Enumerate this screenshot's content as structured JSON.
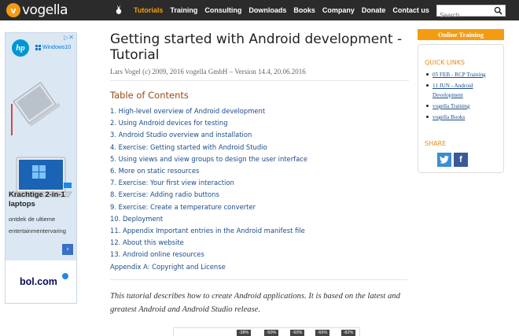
{
  "header": {
    "logo_text": "vogella",
    "nav": [
      "Tutorials",
      "Training",
      "Consulting",
      "Downloads",
      "Books",
      "Company",
      "Donate",
      "Contact us"
    ],
    "search_placeholder": "Search"
  },
  "ad": {
    "brand": "hp",
    "os_label": "Windows10",
    "title": "Krachtige 2-in-1 laptops",
    "subtitle": "ontdek de ultieme entertainmentervaring",
    "shop": "bol.com"
  },
  "article": {
    "title": "Getting started with Android development - Tutorial",
    "byline": "Lars Vogel (c) 2009, 2016 vogella GmbH – Version 14.4, 20.06.2016",
    "toc_title": "Table of Contents",
    "toc": [
      "1. High-level overview of Android development",
      "2. Using Android devices for testing",
      "3. Android Studio overview and installation",
      "4. Exercise: Getting started with Android Studio",
      "5. Using views and view groups to design the user interface",
      "6. More on static resources",
      "7. Exercise: Your first view interaction",
      "8. Exercise: Adding radio buttons",
      "9. Exercise: Create a temperature converter",
      "10. Deployment",
      "11. Appendix Important entries in the Android manifest file",
      "12. About this website",
      "13. Android online resources",
      "Appendix A: Copyright and License"
    ],
    "intro": "This tutorial describes how to create Android applications. It is based on the latest and greatest Android and Android Studio release."
  },
  "bottom_ad": {
    "badges": [
      "-38%",
      "-50%",
      "-60%",
      "-66%",
      "-82%"
    ]
  },
  "sidebar": {
    "online_training": "Online Training",
    "quick_links_title": "QUICK LINKS",
    "quick_links": [
      "05 FEB - RCP Training",
      "11 JUN - Android Development",
      "vogella Training",
      "vogella Books"
    ],
    "share_title": "SHARE"
  }
}
